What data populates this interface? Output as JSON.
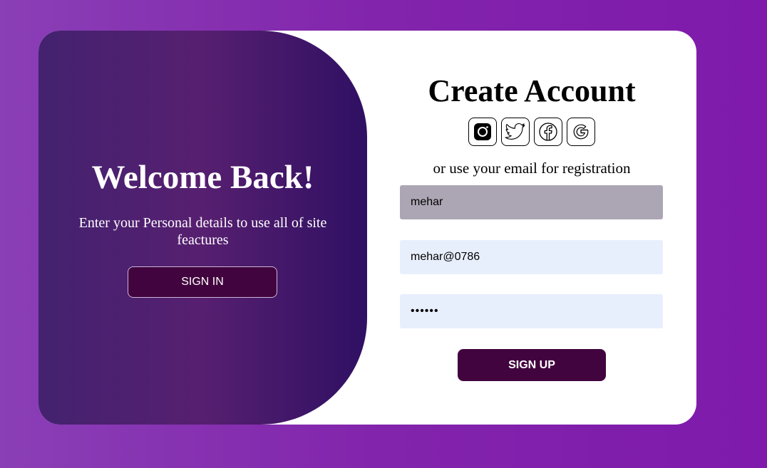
{
  "left_panel": {
    "title": "Welcome Back!",
    "subtitle": "Enter your Personal details to use all of site feactures",
    "signin_label": "SIGN IN"
  },
  "right_panel": {
    "title": "Create Account",
    "social": [
      {
        "icon": "instagram-icon"
      },
      {
        "icon": "twitter-icon"
      },
      {
        "icon": "facebook-icon"
      },
      {
        "icon": "google-icon"
      }
    ],
    "or_text": "or use your email for registration",
    "name_value": "mehar",
    "email_value": "mehar@0786",
    "password_value": "123456",
    "signup_label": "SIGN UP"
  },
  "colors": {
    "background": "#8224ac",
    "left_panel": "#4a1f70",
    "button": "#42043e",
    "input_autofill": "#aca6b4",
    "input": "#e8effc"
  }
}
